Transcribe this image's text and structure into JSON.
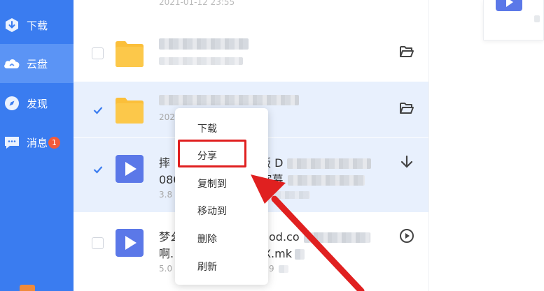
{
  "sidebar": {
    "items": [
      {
        "label": "下载",
        "icon": "download-icon"
      },
      {
        "label": "云盘",
        "icon": "cloud-icon"
      },
      {
        "label": "发现",
        "icon": "compass-icon"
      },
      {
        "label": "消息",
        "icon": "message-icon",
        "badge": "1"
      }
    ]
  },
  "files": [
    {
      "meta": "2021-01-12 23:55",
      "type": "folder"
    },
    {
      "type": "folder",
      "action": "folder-open-icon"
    },
    {
      "title_prefix": "",
      "meta_prefix": "202",
      "type": "folder",
      "action": "folder-open-icon",
      "selected": true
    },
    {
      "title_prefix": "摔",
      "title_mid": "版 D",
      "line2_prefix": "080",
      "line2_mid": "字幕",
      "meta_prefix": "3.8",
      "meta_mid": "30",
      "type": "video",
      "action": "download-arrow-icon",
      "selected": true
    },
    {
      "title_prefix": "梦幺",
      "title_mid": "od.co",
      "line2_prefix": "啊.",
      "line2_mid": "X.mk",
      "meta_prefix": "5.0",
      "meta_mid": "-29",
      "type": "video",
      "action": "play-circle-icon"
    }
  ],
  "context_menu": {
    "items": [
      "下载",
      "分享",
      "复制到",
      "移动到",
      "删除",
      "刷新"
    ]
  },
  "colors": {
    "sidebar": "#3a7cf0",
    "selected_row": "#e8f0fd",
    "folder": "#fbbf3a",
    "video": "#5b78e8",
    "highlight": "#e02020"
  }
}
